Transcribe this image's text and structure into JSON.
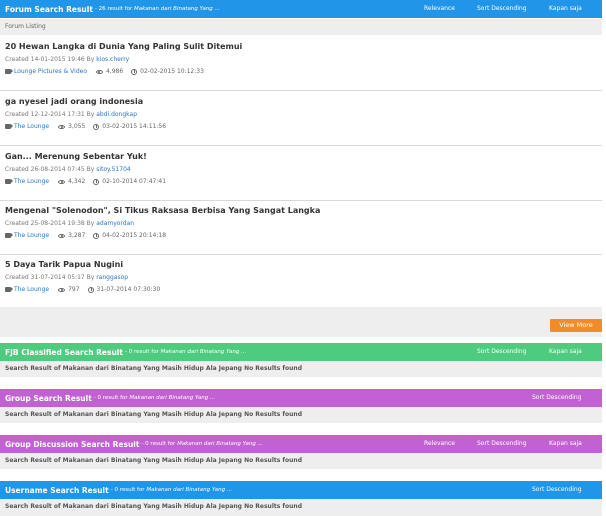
{
  "forum": {
    "title": "Forum Search Result",
    "summary_prefix": " - 26 result for ",
    "query": "Makanan dari Binatang Yang ...",
    "relevance": "Relevance",
    "sort": "Sort Descending",
    "kapan": "Kapan saja",
    "listing_label": "Forum Listing",
    "items": [
      {
        "title": "20 Hewan Langka di Dunia Yang Paling Sulit Ditemui",
        "created": "Created 14-01-2015 19:46 By ",
        "user": "kios.cherry",
        "category": "Lounge Pictures & Video",
        "views": "4,986",
        "last": "02-02-2015 10:12:33"
      },
      {
        "title": "ga nyesel jadi orang indonesia",
        "created": "Created 12-12-2014 17:31 By ",
        "user": "abdi.dongkap",
        "category": "The Lounge",
        "views": "3,055",
        "last": "03-02-2015 14:11:56"
      },
      {
        "title": "Gan... Merenung Sebentar Yuk!",
        "created": "Created 26-08-2014 07:45 By ",
        "user": "sitoy.51704",
        "category": "The Lounge",
        "views": "4,342",
        "last": "02-10-2014 07:47:41"
      },
      {
        "title": "Mengenal \"Solenodon\", Si Tikus Raksasa Berbisa Yang Sangat Langka",
        "created": "Created 25-08-2014 19:38 By ",
        "user": "adamyordan",
        "category": "The Lounge",
        "views": "3,287",
        "last": "04-02-2015 20:14:18"
      },
      {
        "title": "5 Daya Tarik Papua Nugini",
        "created": "Created 31-07-2014 05:17 By ",
        "user": "ranggasop",
        "category": "The Lounge",
        "views": "797",
        "last": "31-07-2014 07:30:30"
      }
    ],
    "view_more": "View More"
  },
  "fjb": {
    "title": "FJB Classified Search Result",
    "summary_prefix": " - 0 result for ",
    "query": "Makanan dari Binatang Yang ...",
    "sort": "Sort Descending",
    "kapan": "Kapan saja",
    "no_result": "Search Result of Makanan dari Binatang Yang Masih Hidup Ala Jepang No Results found"
  },
  "group": {
    "title": "Group Search Result",
    "summary_prefix": " - 0 result for ",
    "query": "Makanan dari Binatang Yang ...",
    "sort": "Sort Descending",
    "no_result": "Search Result of Makanan dari Binatang Yang Masih Hidup Ala Jepang No Results found"
  },
  "discussion": {
    "title": "Group Discussion Search Result",
    "summary_prefix": " - 0 result for ",
    "query": "Makanan dari Binatang Yang ...",
    "relevance": "Relevance",
    "sort": "Sort Descending",
    "kapan": "Kapan saja",
    "no_result": "Search Result of Makanan dari Binatang Yang Masih Hidup Ala Jepang No Results found"
  },
  "username": {
    "title": "Username Search Result",
    "summary_prefix": " - 0 result for ",
    "query": "Makanan dari Binatang Yang ...",
    "sort": "Sort Descending",
    "no_result": "Search Result of Makanan dari Binatang Yang Masih Hidup Ala Jepang No Results found"
  },
  "colors": {
    "blue": "#2196e8",
    "green": "#4ecb7f",
    "purple": "#c262d2",
    "orange": "#f28c28",
    "link": "#2a74c4"
  },
  "icons": [
    "tag-icon",
    "eye-icon",
    "clock-icon"
  ]
}
